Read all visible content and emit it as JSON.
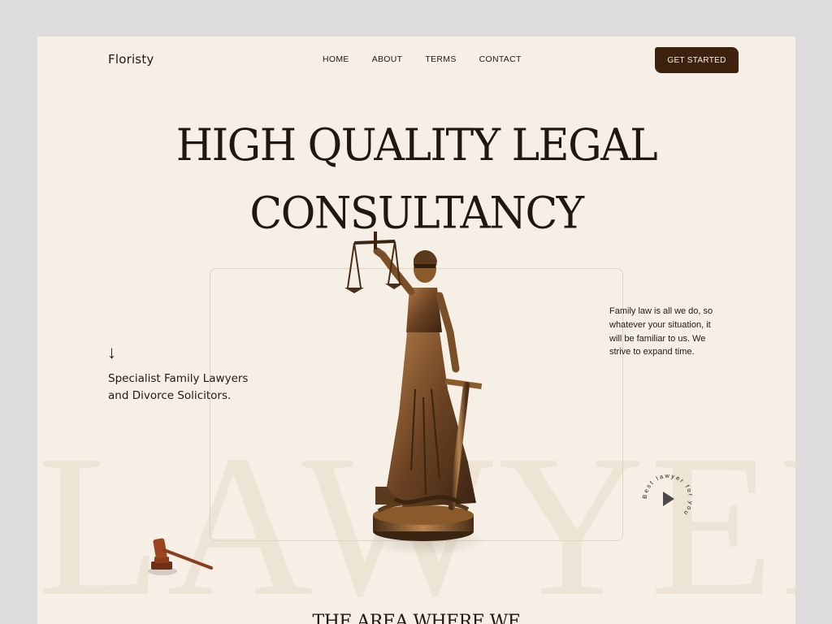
{
  "brand": {
    "name": "Floristy"
  },
  "nav": {
    "items": [
      "HOME",
      "ABOUT",
      "TERMS",
      "CONTACT"
    ],
    "cta_label": "GET STARTED"
  },
  "hero": {
    "title_line1": "HIGH QUALITY LEGAL",
    "title_line2": "CONSULTANCY",
    "tagline_line1": "Specialist Family Lawyers",
    "tagline_line2": "and Divorce Solicitors.",
    "side_text": "Family law is all we do, so whatever your situation, it will be familiar to us. We strive to expand time.",
    "watermark": "LAWYER",
    "arrow_icon": "arrow-down-icon",
    "play_badge_text": "Best lawyer for you"
  },
  "next_section": {
    "title": "THE AREA WHERE WE"
  },
  "colors": {
    "background": "#f5efe5",
    "cta": "#3d230d",
    "text": "#1d1812",
    "bronze": "#8a5a2b"
  }
}
